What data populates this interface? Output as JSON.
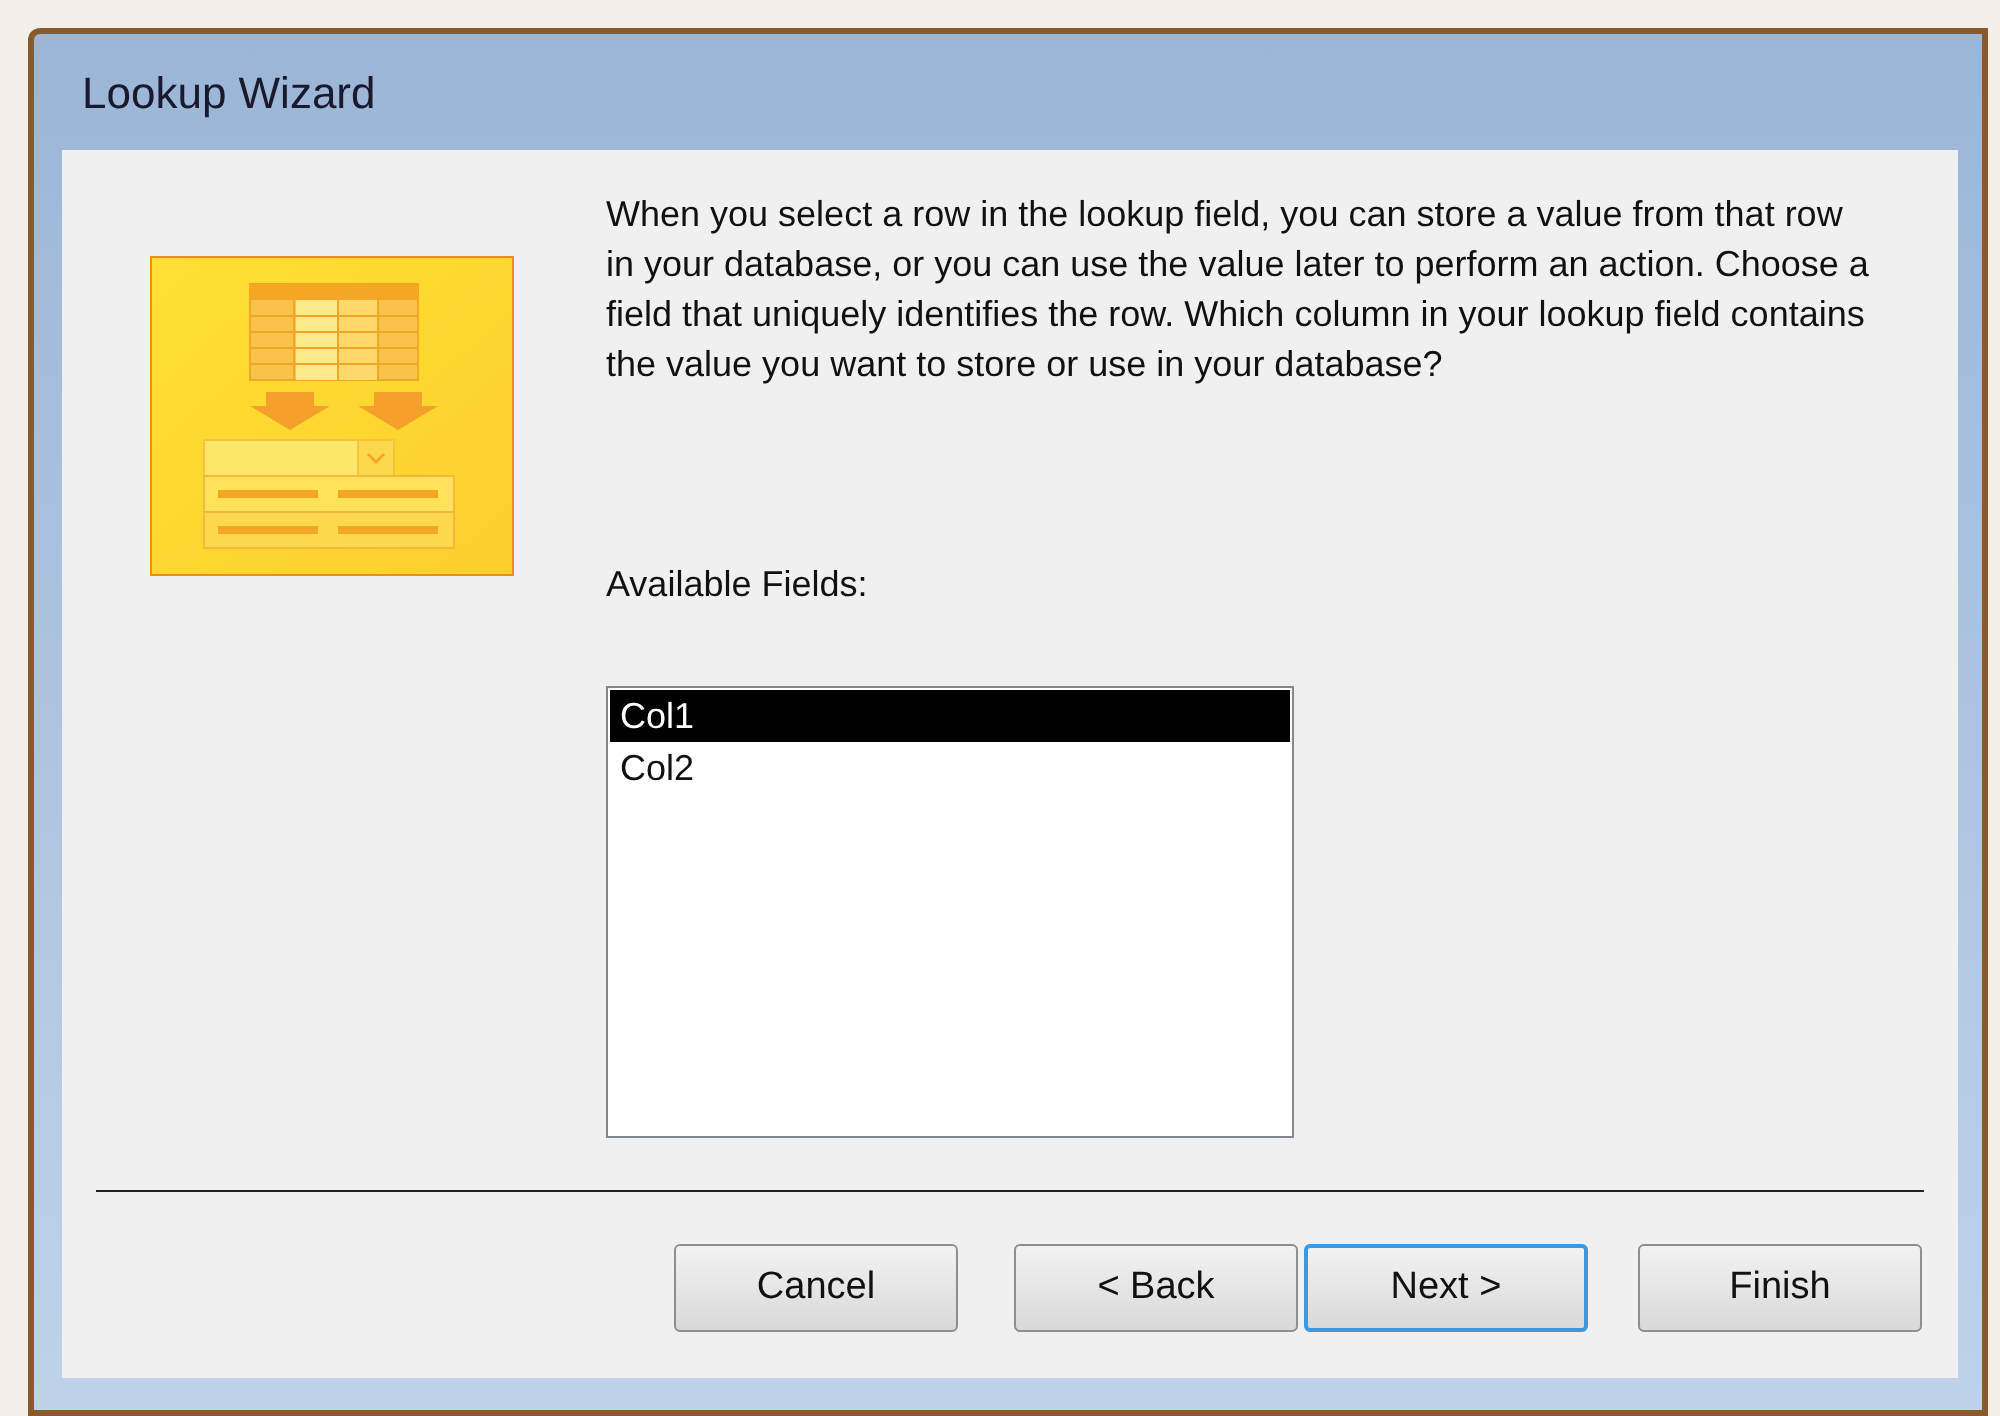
{
  "window": {
    "title": "Lookup Wizard"
  },
  "instructions": "When you select a row in the lookup field, you can store a value from that row in your database, or you can use the value later to perform an action.  Choose a field that uniquely identifies the row. Which column in your lookup field contains the value you want to store or use in your database?",
  "fields_label": "Available Fields:",
  "fields": [
    {
      "label": "Col1",
      "selected": true
    },
    {
      "label": "Col2",
      "selected": false
    }
  ],
  "buttons": [
    {
      "label": "Cancel",
      "default": false
    },
    {
      "label": "< Back",
      "default": false
    },
    {
      "label": "Next >",
      "default": true
    },
    {
      "label": "Finish",
      "default": false
    }
  ]
}
